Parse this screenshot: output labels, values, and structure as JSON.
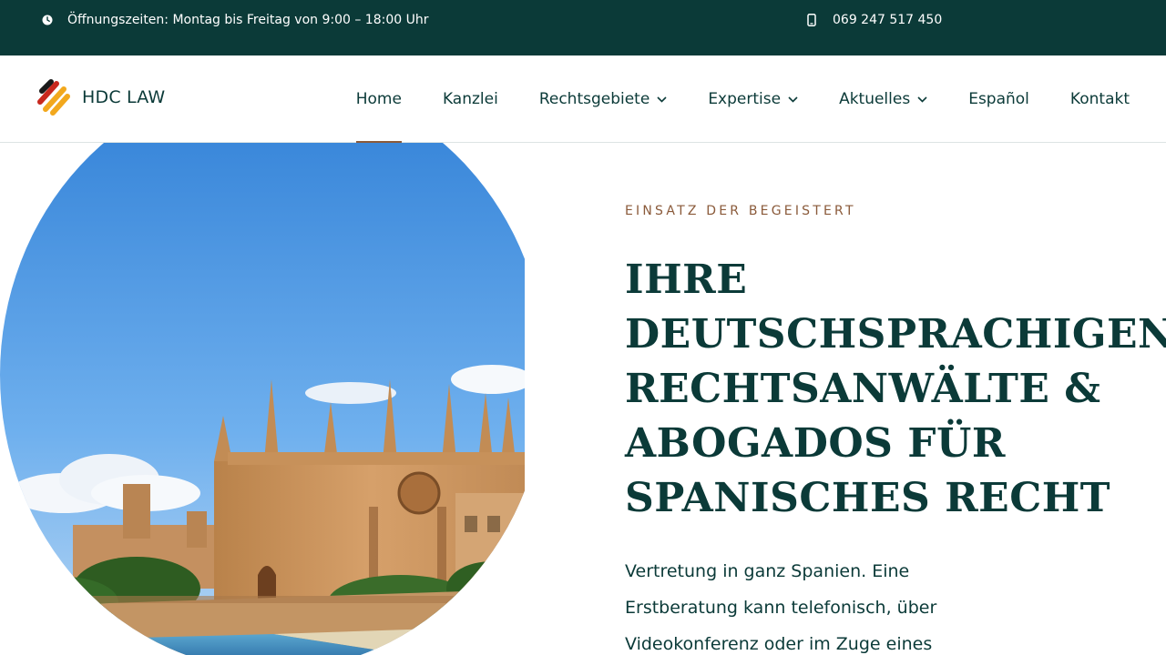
{
  "topbar": {
    "hours_icon": "clock-icon",
    "hours_text": "Öffnungszeiten: Montag bis Freitag von 9:00 – 18:00 Uhr",
    "phone_icon": "mobile-phone-icon",
    "phone_text": "069 247 517 450"
  },
  "header": {
    "brand": "HDC LAW",
    "nav": [
      {
        "label": "Home",
        "active": true,
        "dropdown": false
      },
      {
        "label": "Kanzlei",
        "active": false,
        "dropdown": false
      },
      {
        "label": "Rechtsgebiete",
        "active": false,
        "dropdown": true
      },
      {
        "label": "Expertise",
        "active": false,
        "dropdown": true
      },
      {
        "label": "Aktuelles",
        "active": false,
        "dropdown": true
      },
      {
        "label": "Español",
        "active": false,
        "dropdown": false
      },
      {
        "label": "Kontakt",
        "active": false,
        "dropdown": false
      }
    ]
  },
  "hero": {
    "image_subject": "Kathedrale La Seu, Palma de Mallorca",
    "kicker": "EINSATZ DER BEGEISTERT",
    "headline_lines": [
      "IHRE",
      "DEUTSCHSPRACHIGEN",
      "RECHTSANWÄLTE &",
      "ABOGADOS FÜR",
      "SPANISCHES RECHT"
    ],
    "lead_lines": [
      "Vertretung in ganz Spanien. Eine",
      "Erstberatung kann telefonisch, über",
      "Videokonferenz oder im Zuge eines"
    ]
  },
  "colors": {
    "primary": "#0b3a38",
    "accent": "#8a5a3a",
    "logo_red": "#c8281e",
    "logo_gold": "#f2a81d",
    "logo_dark": "#1a1a1a"
  }
}
